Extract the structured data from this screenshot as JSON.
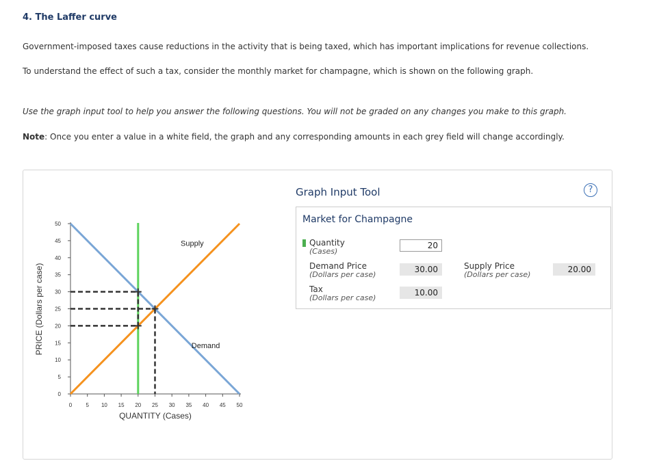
{
  "page": {
    "title": "4. The Laffer curve",
    "para1": "Government-imposed taxes cause reductions in the activity that is being taxed, which has important implications for revenue collections.",
    "para2": "To understand the effect of such a tax, consider the monthly market for champagne, which is shown on the following graph.",
    "instructions": "Use the graph input tool to help you answer the following questions. You will not be graded on any changes you make to this graph.",
    "note_label": "Note",
    "note_text": ": Once you enter a value in a white field, the graph and any corresponding amounts in each grey field will change accordingly."
  },
  "tool": {
    "title": "Graph Input Tool",
    "help_label": "?",
    "market_title": "Market for Champagne",
    "quantity_label": "Quantity",
    "quantity_unit": "(Cases)",
    "quantity_value": "20",
    "demand_price_label": "Demand Price",
    "demand_price_unit": "(Dollars per case)",
    "demand_price_value": "30.00",
    "supply_price_label": "Supply Price",
    "supply_price_unit": "(Dollars per case)",
    "supply_price_value": "20.00",
    "tax_label": "Tax",
    "tax_unit": "(Dollars per case)",
    "tax_value": "10.00"
  },
  "colors": {
    "supply": "#f5921e",
    "demand": "#7aa6d6",
    "quantity_line": "#5dd35d",
    "dashed": "#333333"
  },
  "chart_data": {
    "type": "line",
    "xlabel": "QUANTITY (Cases)",
    "ylabel": "PRICE (Dollars per case)",
    "xlim": [
      0,
      50
    ],
    "ylim": [
      0,
      50
    ],
    "x_ticks": [
      "0",
      "5",
      "10",
      "15",
      "20",
      "25",
      "30",
      "35",
      "40",
      "45",
      "50"
    ],
    "y_ticks": [
      "0",
      "5",
      "10",
      "15",
      "20",
      "25",
      "30",
      "35",
      "40",
      "45",
      "50"
    ],
    "series": [
      {
        "name": "Supply",
        "points": [
          [
            0,
            0
          ],
          [
            50,
            50
          ]
        ]
      },
      {
        "name": "Demand",
        "points": [
          [
            0,
            50
          ],
          [
            50,
            0
          ]
        ]
      }
    ],
    "supply_label": "Supply",
    "demand_label": "Demand",
    "quantity_line_x": 20,
    "equilibrium": [
      25,
      25
    ],
    "tax_point_demand": [
      20,
      30
    ],
    "tax_point_supply": [
      20,
      20
    ]
  }
}
